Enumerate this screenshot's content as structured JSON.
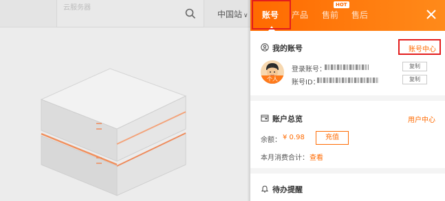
{
  "background": {
    "search_placeholder": "云服务器",
    "region_label": "中国站",
    "region_chevron": "∨"
  },
  "panel": {
    "tabs": [
      {
        "label": "账号",
        "active": true
      },
      {
        "label": "产品",
        "active": false
      },
      {
        "label": "售前",
        "active": false,
        "badge": "HOT"
      },
      {
        "label": "售后",
        "active": false
      }
    ],
    "close_icon": "close-icon",
    "my_account": {
      "title": "我的账号",
      "center_link": "账号中心",
      "avatar_badge": "个人",
      "login_label": "登录账号：",
      "id_label": "账号ID：",
      "copy_label": "复制"
    },
    "overview": {
      "title": "账户总览",
      "user_center_link": "用户中心",
      "balance_label": "余额：",
      "balance_value": "¥ 0.98",
      "recharge_label": "充值",
      "monthly_label": "本月消费合计：",
      "view_link": "查看"
    },
    "todo": {
      "title": "待办提醒"
    }
  },
  "colors": {
    "brand_orange": "#ff6a00",
    "highlight_red": "#e31d1d"
  }
}
